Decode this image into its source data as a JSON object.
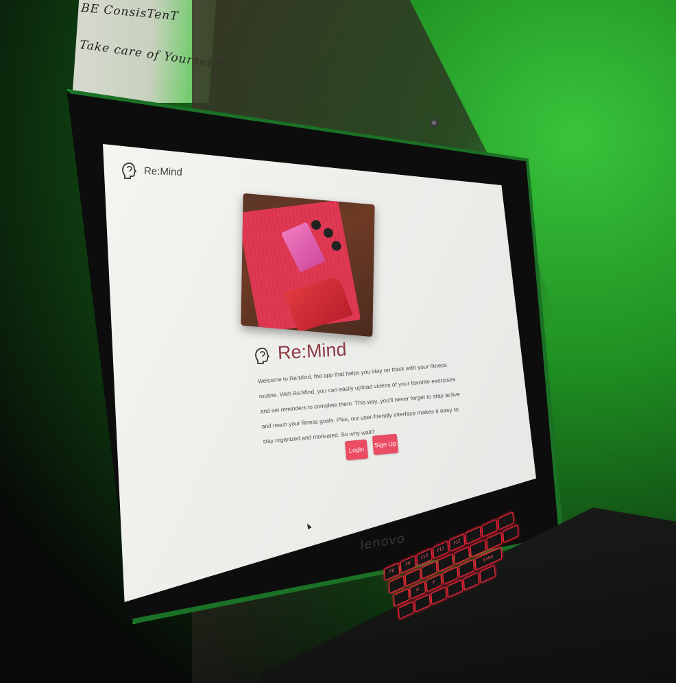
{
  "wall_note": {
    "lines": [
      "BE ConsisTenT",
      "Take care of YourseLF"
    ]
  },
  "laptop": {
    "brand": "lenovo"
  },
  "app": {
    "header_title": "Re:Mind",
    "title": "Re:Mind",
    "description": "Welcome to Re:Mind, the app that helps you stay on track with your fitness routine. With Re:Mind, you can easily upload videos of your favorite exercises and set reminders to complete them. This way, you'll never forget to stay active and reach your fitness goals. Plus, our user-friendly interface makes it easy to stay organized and motivated. So why wait?",
    "login_label": "Login",
    "signup_label": "Sign Up",
    "accent_color": "#ea4c63",
    "title_color": "#8b3a45"
  },
  "keyboard": {
    "visible_key_labels": [
      "F8",
      "F9",
      "F10",
      "F11",
      "F12",
      "O",
      "P",
      "Enter"
    ]
  }
}
